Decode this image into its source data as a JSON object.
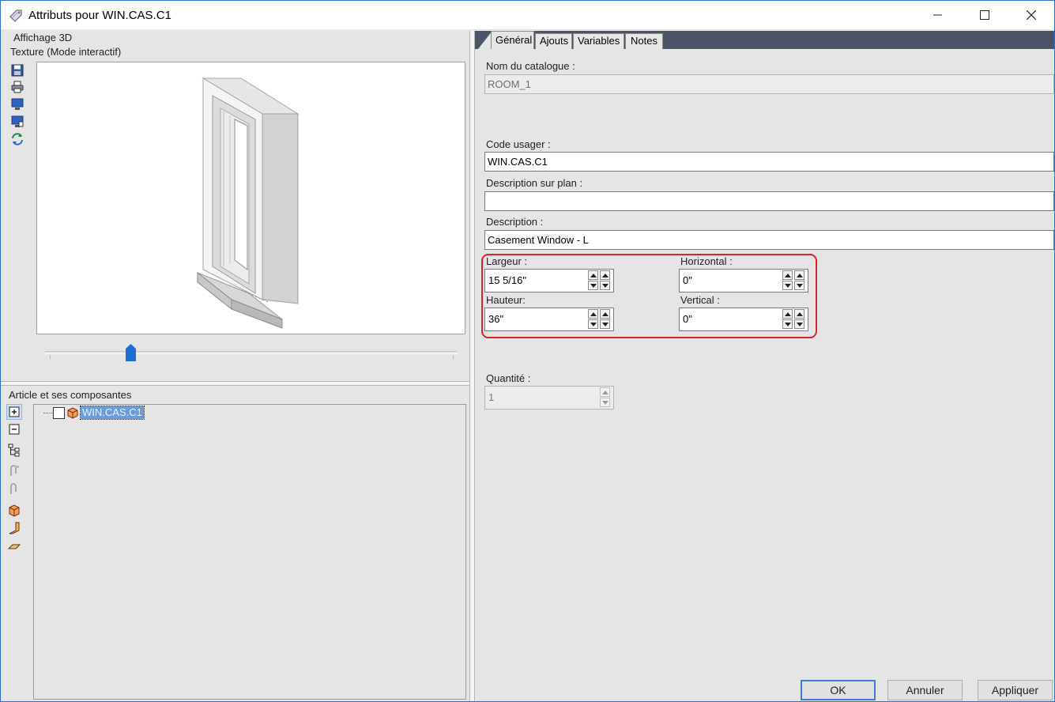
{
  "window": {
    "title": "Attributs pour WIN.CAS.C1",
    "controls": {
      "minimize": "minimize-icon",
      "maximize": "maximize-icon",
      "close": "close-icon"
    }
  },
  "left": {
    "group_3d": "Affichage 3D",
    "texture_mode": "Texture (Mode interactif)",
    "view_tools": [
      "save-icon",
      "print-icon",
      "monitor-icon",
      "monitor-export-icon",
      "refresh-icon"
    ],
    "components_caption": "Article et ses composantes",
    "tree_tools": [
      "expand-icon",
      "collapse-icon",
      "hierarchy-icon",
      "attach-icon",
      "detach-icon",
      "box-icon",
      "wall-icon",
      "floor-icon"
    ],
    "tree": {
      "item_label": "WIN.CAS.C1",
      "checked": false
    }
  },
  "tabs": [
    {
      "label": "Général",
      "active": true
    },
    {
      "label": "Ajouts",
      "active": false
    },
    {
      "label": "Variables",
      "active": false
    },
    {
      "label": "Notes",
      "active": false
    }
  ],
  "form": {
    "catalogue_label": "Nom du catalogue :",
    "catalogue_value": "ROOM_1",
    "code_label": "Code usager :",
    "code_value": "WIN.CAS.C1",
    "plan_desc_label": "Description sur plan :",
    "plan_desc_value": "",
    "desc_label": "Description :",
    "desc_value": "Casement Window - L",
    "largeur_label": "Largeur :",
    "largeur_value": "15 5/16\"",
    "horizontal_label": "Horizontal :",
    "horizontal_value": "0\"",
    "hauteur_label": "Hauteur:",
    "hauteur_value": "36\"",
    "vertical_label": "Vertical :",
    "vertical_value": "0\"",
    "quantite_label": "Quantité :",
    "quantite_value": "1"
  },
  "buttons": {
    "ok": "OK",
    "cancel": "Annuler",
    "apply": "Appliquer"
  },
  "colors": {
    "highlight": "#e0202a",
    "tab_strip": "#4a5568",
    "selection": "#6b9bd9",
    "slider_thumb": "#1e6fd0"
  }
}
